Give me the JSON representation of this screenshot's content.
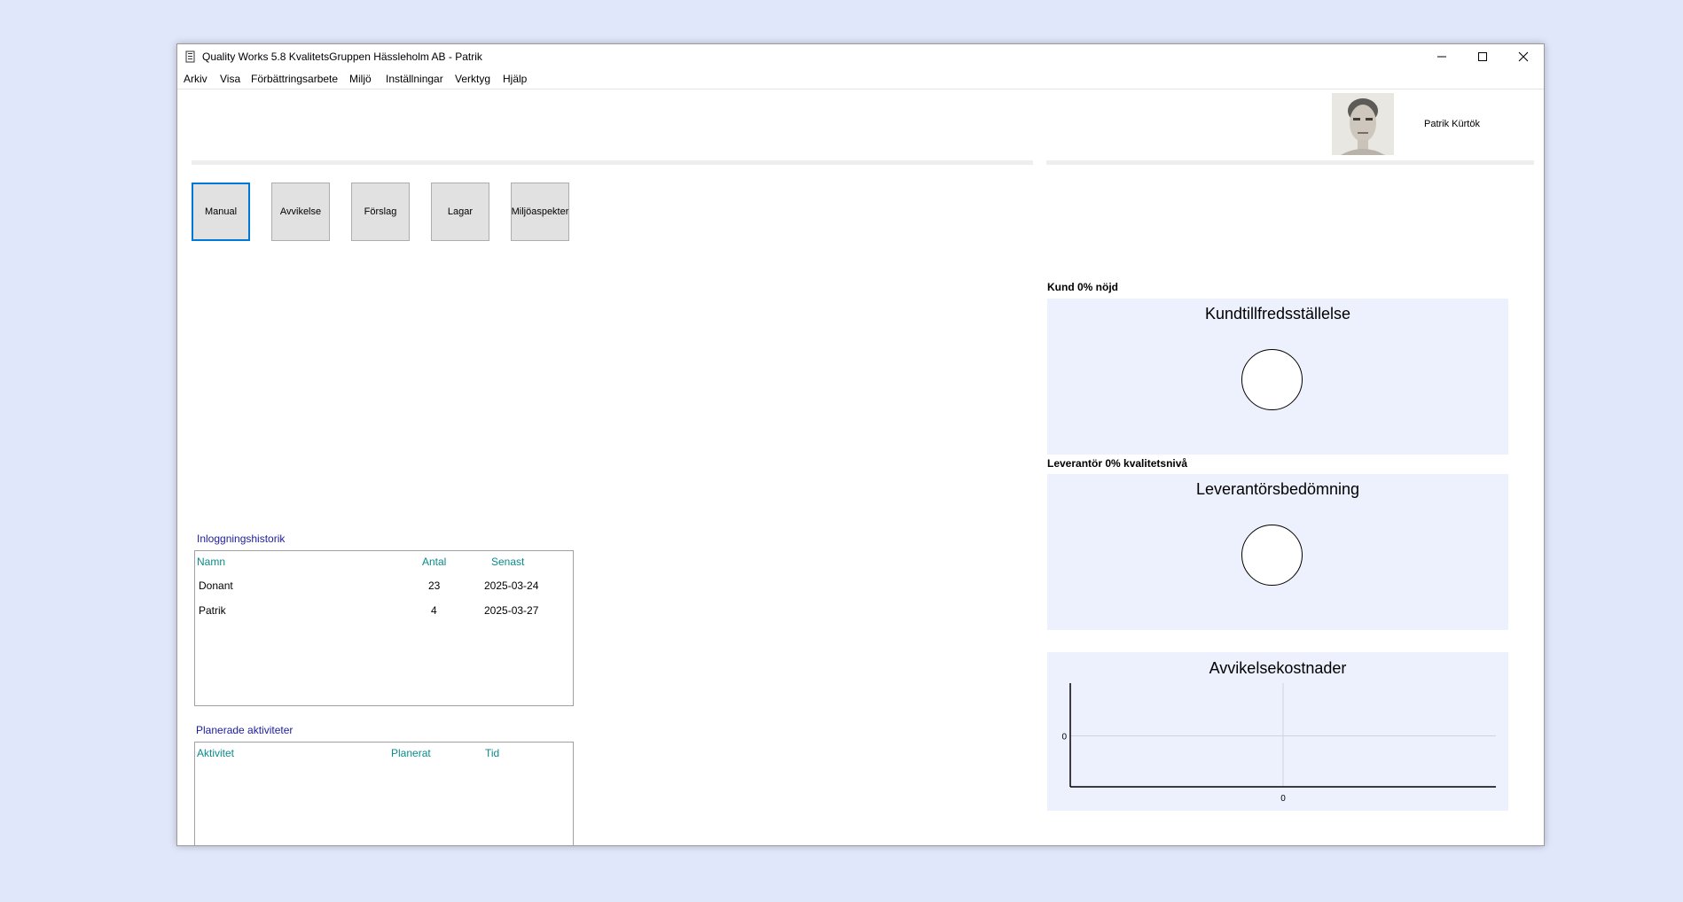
{
  "window": {
    "title": "Quality Works 5.8 KvalitetsGruppen Hässleholm AB - Patrik",
    "controls": [
      "minimize",
      "maximize",
      "close"
    ]
  },
  "menu": [
    "Arkiv",
    "Visa",
    "Förbättringsarbete",
    "Miljö",
    "Inställningar",
    "Verktyg",
    "Hjälp"
  ],
  "user": {
    "name": "Patrik Kürtök"
  },
  "modules": [
    "Manual",
    "Avvikelse",
    "Förslag",
    "Lagar",
    "Miljöaspekter"
  ],
  "login_history": {
    "title": "Inloggningshistorik",
    "columns": [
      "Namn",
      "Antal",
      "Senast"
    ],
    "rows": [
      {
        "name": "Donant",
        "count": "23",
        "last": "2025-03-24"
      },
      {
        "name": "Patrik",
        "count": "4",
        "last": "2025-03-27"
      }
    ]
  },
  "planned": {
    "title": "Planerade aktiviteter",
    "columns": [
      "Aktivitet",
      "Planerat",
      "Tid"
    ]
  },
  "kpis": {
    "customer_label": "Kund  0% nöjd",
    "customer_title": "Kundtillfredsställelse",
    "supplier_label": "Leverantör 0% kvalitetsnivå",
    "supplier_title": "Leverantörsbedömning",
    "costs_title": "Avvikelsekostnader"
  },
  "chart_data": {
    "type": "line",
    "title": "Avvikelsekostnader",
    "x": [
      0
    ],
    "y": [
      0
    ],
    "x_ticks": [
      "0"
    ],
    "y_ticks": [
      "0"
    ],
    "grid": true
  },
  "colors": {
    "accent": "#0078d7",
    "panel_bg": "#edf1fd",
    "header_text": "#0b8a8a",
    "section_text": "#1c1c9c"
  }
}
